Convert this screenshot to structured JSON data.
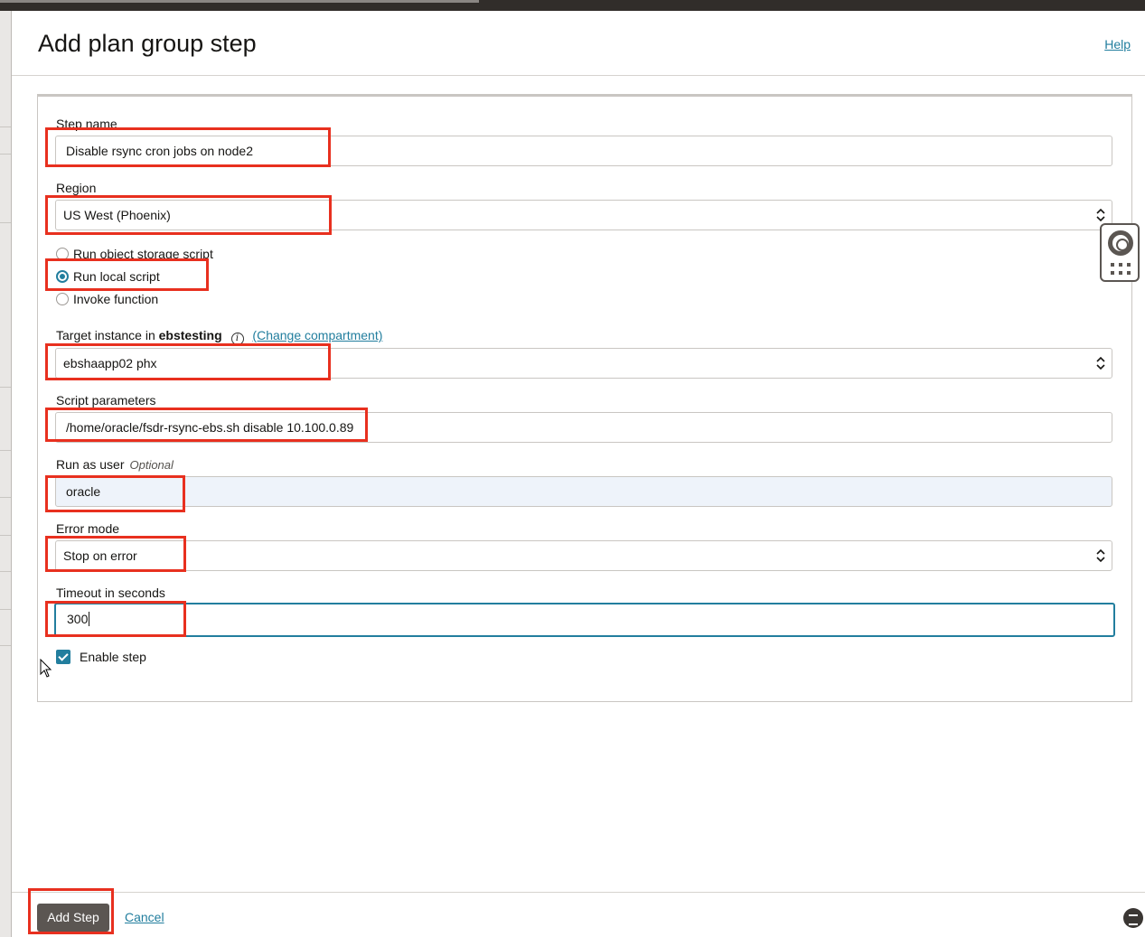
{
  "panel": {
    "title": "Add plan group step",
    "help_link": "Help"
  },
  "form": {
    "step_name": {
      "label": "Step name",
      "value": "Disable rsync cron jobs on node2"
    },
    "region": {
      "label": "Region",
      "value": "US West (Phoenix)"
    },
    "script_type": {
      "options": [
        "Run object storage script",
        "Run local script",
        "Invoke function"
      ],
      "selected": "Run local script"
    },
    "target_instance": {
      "label_prefix": "Target instance in",
      "compartment": "ebstesting",
      "info_icon": "info-icon",
      "change_link": "(Change compartment)",
      "value": "ebshaapp02 phx"
    },
    "script_parameters": {
      "label": "Script parameters",
      "value": "/home/oracle/fsdr-rsync-ebs.sh disable 10.100.0.89"
    },
    "run_as_user": {
      "label": "Run as user",
      "optional": "Optional",
      "value": "oracle"
    },
    "error_mode": {
      "label": "Error mode",
      "value": "Stop on error"
    },
    "timeout": {
      "label": "Timeout in seconds",
      "value": "300"
    },
    "enable_step": {
      "label": "Enable step",
      "checked": true
    }
  },
  "footer": {
    "add_step_label": "Add Step",
    "cancel_label": "Cancel"
  },
  "colors": {
    "accent": "#227e9e",
    "highlight": "#e8301f",
    "button_bg": "#5b5652",
    "topbar": "#312d2a"
  }
}
